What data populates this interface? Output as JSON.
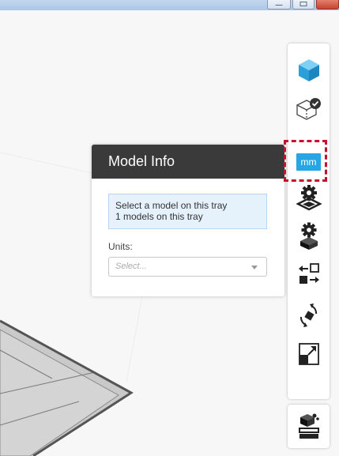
{
  "panel": {
    "title": "Model Info",
    "info_line1": "Select a model on this tray",
    "info_line2": "1 models on this tray",
    "units_label": "Units:",
    "units_placeholder": "Select..."
  },
  "toolbar": {
    "items": [
      {
        "name": "add-model",
        "icon": "cube-icon"
      },
      {
        "name": "check-model",
        "icon": "cube-check-icon"
      },
      {
        "name": "model-info",
        "icon": "mm-icon",
        "label": "mm"
      },
      {
        "name": "tray-settings",
        "icon": "gear-tray-icon"
      },
      {
        "name": "model-settings",
        "icon": "gear-cube-icon"
      },
      {
        "name": "move",
        "icon": "move-icon"
      },
      {
        "name": "rotate",
        "icon": "rotate-icon"
      },
      {
        "name": "scale",
        "icon": "scale-icon"
      }
    ],
    "bottom_item": {
      "name": "print",
      "icon": "print-icon"
    }
  },
  "colors": {
    "accent": "#27a6e5",
    "highlight": "#c8102e",
    "panel_header": "#3a3a3a"
  }
}
